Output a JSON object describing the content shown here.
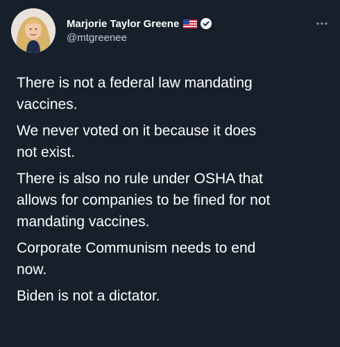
{
  "tweet": {
    "author": {
      "display_name": "Marjorie Taylor Greene",
      "handle": "@mtgreenee",
      "flag_icon": "us-flag-icon",
      "verified_icon": "verified-badge-icon",
      "avatar_icon": "profile-avatar"
    },
    "menu_icon": "more-options-icon",
    "paragraphs": [
      "There is not a federal law mandating\nvaccines.",
      "We never voted on it because it does\nnot exist.",
      "There is also no rule under OSHA that\nallows for companies to be fined for not\nmandating vaccines.",
      "Corporate Communism needs to end\nnow.",
      "Biden is not a dictator."
    ]
  },
  "colors": {
    "background": "#15202b",
    "text": "#ffffff",
    "handle": "#c8ccd1",
    "verified": "#1d9bf0"
  }
}
